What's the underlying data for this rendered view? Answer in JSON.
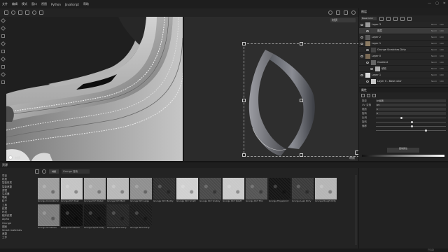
{
  "menubar": {
    "items": [
      "文件",
      "编辑",
      "模式",
      "窗口",
      "视图",
      "Python",
      "JavaScript",
      "帮助"
    ],
    "window_controls": [
      "—",
      "▢",
      "✕"
    ]
  },
  "viewport3d": {
    "label": "材质",
    "axis_icon": "axis-gizmo-icon"
  },
  "viewport2d": {
    "label": "材质",
    "dropdown": "材质"
  },
  "rightpanel": {
    "title": "图层",
    "blend_select": "Base Color",
    "layers": [
      {
        "name": "Layer 3",
        "blend": "Norm",
        "opacity": "100",
        "level": 0,
        "thumb": "#9a9a9a",
        "selected": false
      },
      {
        "name": "图层",
        "blend": "Norm",
        "opacity": "100",
        "level": 1,
        "thumb": "#3d3d3d",
        "selected": true
      },
      {
        "name": "Layer 2",
        "blend": "Norm",
        "opacity": "100",
        "level": 0,
        "thumb": "#5a5a5a",
        "selected": false
      },
      {
        "name": "Layer 1",
        "blend": "Norm",
        "opacity": "100",
        "level": 0,
        "thumb": "#8a7a62",
        "selected": false
      },
      {
        "name": "Grunge Scratches Dirty",
        "blend": "Norm",
        "opacity": "100",
        "level": 1,
        "thumb": "#444444",
        "selected": false
      },
      {
        "name": "Layer 0",
        "blend": "Norm",
        "opacity": "100",
        "level": 0,
        "thumb": "#7a6a55",
        "selected": false
      },
      {
        "name": "Gradient",
        "blend": "Norm",
        "opacity": "100",
        "level": 1,
        "thumb": "#666666",
        "selected": false
      },
      {
        "name": "填充",
        "blend": "Norm",
        "opacity": "100",
        "level": 2,
        "thumb": "#b0b0b0",
        "selected": false
      },
      {
        "name": "Layer 1",
        "blend": "Norm",
        "opacity": "100",
        "level": 0,
        "thumb": "#d7d7d7",
        "selected": false
      },
      {
        "name": "Layer 0 - Base color",
        "blend": "Norm",
        "opacity": "100",
        "level": 1,
        "thumb": "#c9c9c9",
        "selected": false
      }
    ]
  },
  "props": {
    "title": "属性",
    "rows": [
      {
        "label": "投影",
        "value": "UV投影"
      },
      {
        "label": "UV 变换",
        "value": "UV"
      },
      {
        "label": "缩放",
        "value": "1"
      },
      {
        "label": "旋转",
        "value": "0"
      }
    ],
    "sliders": [
      {
        "label": "比例",
        "value": 0.35
      },
      {
        "label": "旋转",
        "value": 0.5
      },
      {
        "label": "偏移",
        "value": 0.5
      },
      {
        "label": "",
        "value": 0.7
      }
    ],
    "button_label": "图像属性",
    "gradient_label": "灰度"
  },
  "shelf": {
    "title": "资源",
    "search_placeholder": "Grunge 搜索",
    "filter": "材质",
    "categories": [
      "项目",
      "材质",
      "智能材质",
      "智能遮罩",
      "滤镜",
      "生成器",
      "笔刷",
      "粒子",
      "工具",
      "纹理",
      "环境",
      "程序纹理",
      "Alpha",
      "Grunge",
      "图案",
      "Smart materials",
      "遮罩",
      "工作"
    ],
    "tiles": [
      {
        "name": "Grunge Concrete Sc",
        "tone": "#9e9e9e",
        "row": 0,
        "col": 0
      },
      {
        "name": "Grunge Dirt Dust",
        "tone": "#c4c4c4",
        "row": 0,
        "col": 1
      },
      {
        "name": "Grunge Dirt Detail",
        "tone": "#a9a9a9",
        "row": 0,
        "col": 2
      },
      {
        "name": "Grunge Dirt Mark",
        "tone": "#b8b8b8",
        "row": 0,
        "col": 3
      },
      {
        "name": "Grunge Dirt Large",
        "tone": "#8f8f8f",
        "row": 0,
        "col": 4
      },
      {
        "name": "Grunge Dirt Muddy",
        "tone": "#2f2f2f",
        "row": 0,
        "col": 5
      },
      {
        "name": "Grunge Dirt Scratc",
        "tone": "#d0d0d0",
        "row": 0,
        "col": 6
      },
      {
        "name": "Grunge Dirt Scabby",
        "tone": "#4a4a4a",
        "row": 0,
        "col": 7
      },
      {
        "name": "Grunge Dirt Splatt",
        "tone": "#c9c9c9",
        "row": 0,
        "col": 8
      },
      {
        "name": "Grunge Dirt Thin",
        "tone": "#555555",
        "row": 0,
        "col": 9
      },
      {
        "name": "Grunge Fingerprint",
        "tone": "#151515",
        "row": 0,
        "col": 10
      },
      {
        "name": "Grunge Leak Dirty",
        "tone": "#3b3b3b",
        "row": 0,
        "col": 11
      },
      {
        "name": "Grunge Rough Dirty",
        "tone": "#b5b5b5",
        "row": 0,
        "col": 12
      },
      {
        "name": "Grunge Scratches",
        "tone": "#7d7d7d",
        "row": 1,
        "col": 0
      },
      {
        "name": "Grunge Scratches",
        "tone": "#0d0d0d",
        "row": 1,
        "col": 1
      },
      {
        "name": "Grunge Spots Dirty",
        "tone": "#141414",
        "row": 1,
        "col": 2
      },
      {
        "name": "Grunge Wool Dirty",
        "tone": "#262626",
        "row": 1,
        "col": 3
      },
      {
        "name": "Grunge Wool Dirty",
        "tone": "#1c1c1c",
        "row": 1,
        "col": 4
      }
    ]
  },
  "status": {
    "text": "已渲染"
  }
}
